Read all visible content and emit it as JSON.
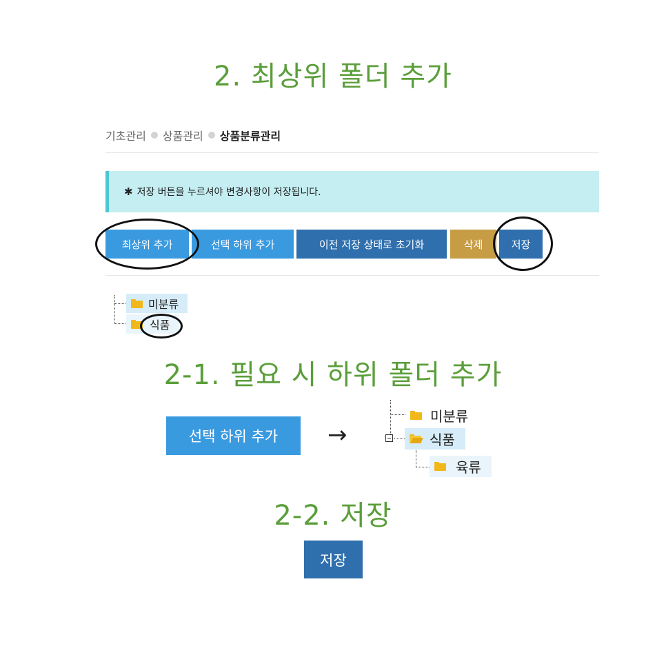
{
  "headings": {
    "main": "2. 최상위 폴더 추가",
    "sub1": "2-1. 필요 시 하위 폴더 추가",
    "sub2": "2-2. 저장"
  },
  "breadcrumb": {
    "items": [
      "기초관리",
      "상품관리"
    ],
    "current": "상품분류관리"
  },
  "alert": {
    "icon": "✱",
    "text": "저장 버튼을 누르셔야 변경사항이 저장됩니다."
  },
  "toolbar": {
    "add_top": "최상위 추가",
    "add_child": "선택 하위 추가",
    "reset": "이전 저장 상태로 초기화",
    "delete": "삭제",
    "save": "저장"
  },
  "tree_before": {
    "nodes": [
      "미분류",
      "식품"
    ]
  },
  "example_child": {
    "button": "선택 하위 추가",
    "arrow": "→",
    "nodes": [
      "미분류",
      "식품",
      "육류"
    ]
  },
  "save_example": {
    "button": "저장"
  },
  "colors": {
    "heading": "#5a9e3a",
    "btn_light": "#3a9ae0",
    "btn_dark": "#2f6fad",
    "btn_gold": "#c69c45",
    "alert_bg": "#c4eef1",
    "folder": "#f1b81b"
  }
}
